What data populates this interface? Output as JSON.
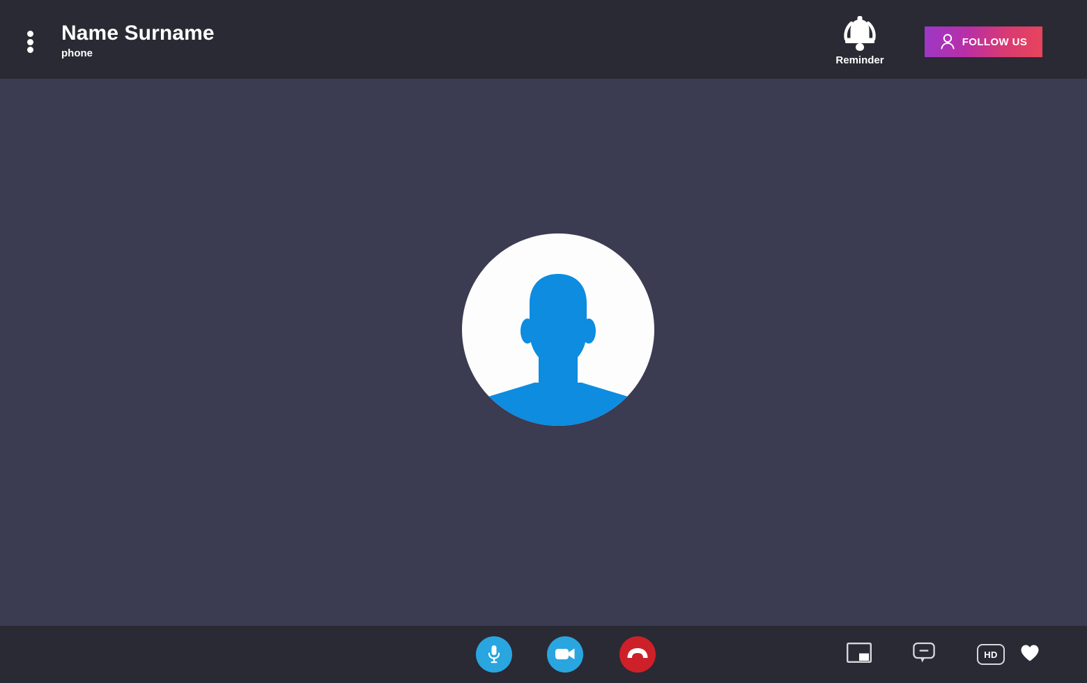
{
  "header": {
    "menu_icon": "kebab-menu-icon",
    "contact_name": "Name Surname",
    "contact_subtitle": "phone",
    "reminder": {
      "icon": "bell-ringing-icon",
      "label": "Reminder"
    },
    "follow_button": {
      "icon": "person-outline-icon",
      "label": "FOLLOW US",
      "gradient_start": "#9b38c6",
      "gradient_end": "#e8455a"
    },
    "background_color": "#2a2a34"
  },
  "stage": {
    "background_color": "#3b3b52",
    "avatar": {
      "icon": "person-avatar-placeholder",
      "circle_color": "#fdfdfd",
      "silhouette_color": "#0d8ce0"
    }
  },
  "controls": {
    "background_color": "#2a2a34",
    "primary": [
      {
        "name": "microphone",
        "icon": "microphone-icon",
        "color": "#29a6e0"
      },
      {
        "name": "camera",
        "icon": "video-camera-icon",
        "color": "#29a6e0"
      },
      {
        "name": "hangup",
        "icon": "phone-hangup-icon",
        "color": "#ce2029"
      }
    ],
    "utility": [
      {
        "name": "picture-in-picture",
        "icon": "picture-in-picture-icon"
      },
      {
        "name": "chat",
        "icon": "chat-bubble-icon"
      },
      {
        "name": "quality",
        "icon": "hd-badge-icon",
        "label": "HD"
      },
      {
        "name": "favorite",
        "icon": "heart-icon"
      }
    ]
  }
}
